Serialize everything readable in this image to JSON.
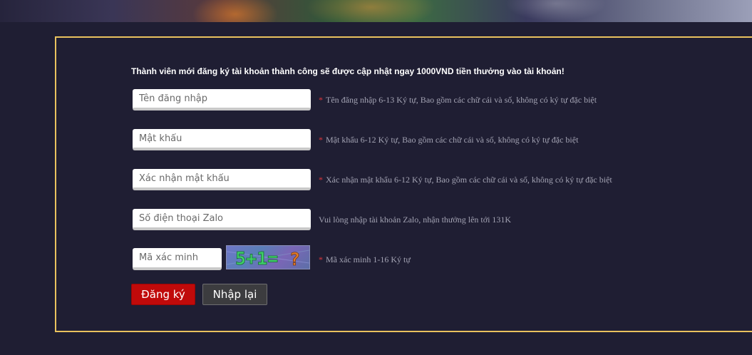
{
  "notice": "Thành viên mới đăng ký tài khoản thành công sẽ được cập nhật ngay 1000VND tiền thưởng vào tài khoản!",
  "fields": {
    "username": {
      "placeholder": "Tên đăng nhập",
      "value": "",
      "hint": "Tên đăng nhập 6-13 Ký tự, Bao gồm các chữ cái và số, không có ký tự đặc biệt",
      "required": true
    },
    "password": {
      "placeholder": "Mật khẩu",
      "value": "",
      "hint": "Mật khẩu 6-12 Ký tự, Bao gồm các chữ cái và số, không có ký tự đặc biệt",
      "required": true
    },
    "confirm_password": {
      "placeholder": "Xác nhận mật khẩu",
      "value": "",
      "hint": "Xác nhận mật khẩu 6-12 Ký tự, Bao gồm các chữ cái và số, không có ký tự đặc biệt",
      "required": true
    },
    "zalo_phone": {
      "placeholder": "Số điện thoại Zalo",
      "value": "",
      "hint": "Vui lòng nhập tài khoản Zalo, nhận thưởng lên tới 131K",
      "required": false
    },
    "captcha_code": {
      "placeholder": "Mã xác minh",
      "value": "",
      "hint": "Mã xác minh 1-16 Ký tự",
      "required": true
    }
  },
  "required_mark": "*",
  "captcha_image": {
    "text_left": "5+1=",
    "text_right": "?"
  },
  "buttons": {
    "register": "Đăng ký",
    "reset": "Nhập lại"
  },
  "colors": {
    "panel_border": "#e9c25e",
    "background": "#1f1e33",
    "register_button": "#c00a0a",
    "reset_button": "#3c3c3f",
    "required_mark": "#e0373c"
  }
}
